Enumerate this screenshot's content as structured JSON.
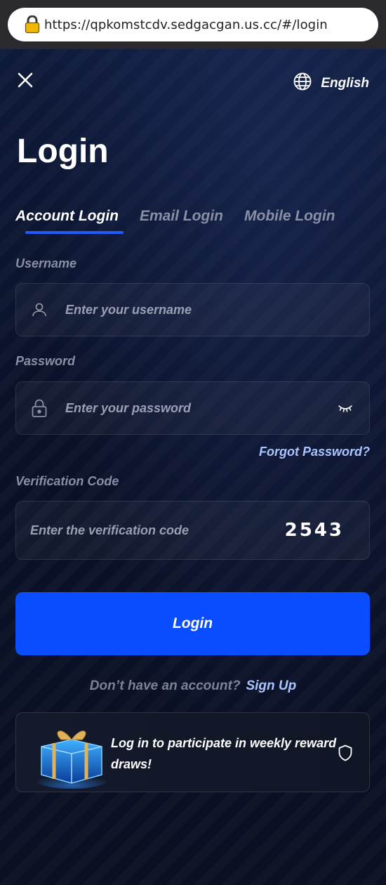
{
  "browser": {
    "url": "https://qpkomstcdv.sedgacgan.us.cc/#/login",
    "lock_icon": "padlock-icon"
  },
  "header": {
    "close_icon": "close-icon",
    "language_icon": "globe-icon",
    "language_label": "English"
  },
  "title": "Login",
  "tabs": [
    {
      "label": "Account Login",
      "active": true
    },
    {
      "label": "Email Login",
      "active": false
    },
    {
      "label": "Mobile Login",
      "active": false
    }
  ],
  "form": {
    "username": {
      "label": "Username",
      "placeholder": "Enter your username",
      "icon": "user-icon"
    },
    "password": {
      "label": "Password",
      "placeholder": "Enter your password",
      "icon": "lock-icon",
      "toggle_icon": "eye-closed-icon"
    },
    "forgot": "Forgot Password?",
    "verification": {
      "label": "Verification Code",
      "placeholder": "Enter the verification code",
      "captcha": "2543"
    },
    "submit": "Login"
  },
  "signup": {
    "question": "Don’t have an account?",
    "link": "Sign Up"
  },
  "banner": {
    "text": "Log in to participate in weekly reward draws!",
    "icon": "gift-box-icon",
    "shield_icon": "shield-icon"
  },
  "colors": {
    "accent": "#0a4dff",
    "link": "#a9c4ff",
    "background": "#0b1024"
  }
}
